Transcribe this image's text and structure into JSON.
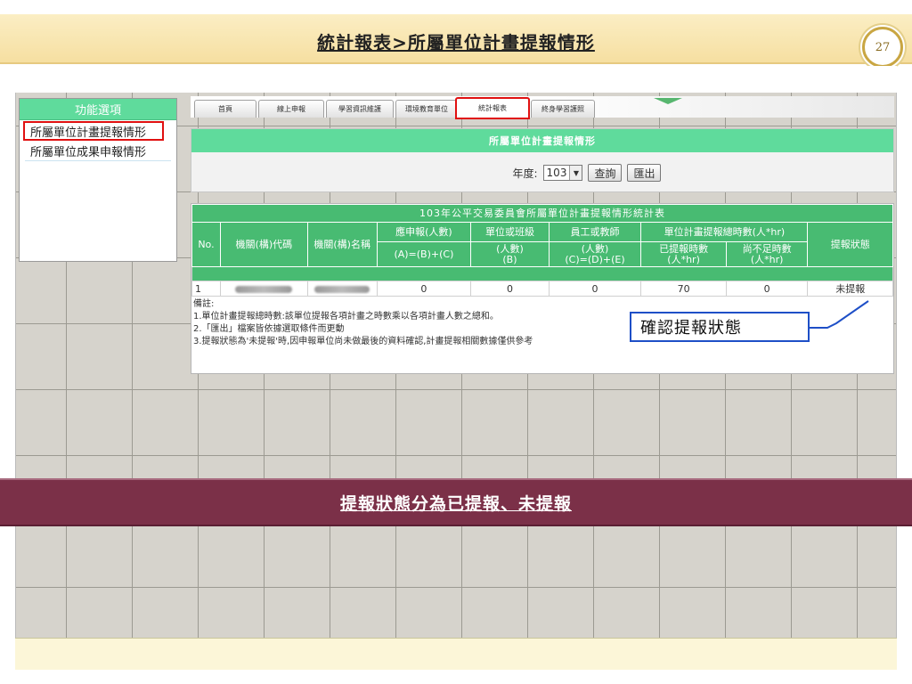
{
  "slide": {
    "title": "統計報表>所屬單位計畫提報情形",
    "page_number": "27",
    "banner": "提報狀態分為已提報、未提報",
    "callout": "確認提報狀態"
  },
  "sidebar": {
    "header": "功能選項",
    "items": [
      {
        "label": "所屬單位計畫提報情形",
        "active": true
      },
      {
        "label": "所屬單位成果申報情形",
        "active": false
      }
    ]
  },
  "tabs": [
    {
      "label": "首頁"
    },
    {
      "label": "線上申報"
    },
    {
      "label": "學習資訊維護"
    },
    {
      "label": "環境教育單位"
    },
    {
      "label": "統計報表",
      "active": true
    },
    {
      "label": "終身學習護照"
    }
  ],
  "main": {
    "title": "所屬單位計畫提報情形",
    "year_label": "年度:",
    "year_value": "103",
    "query_button": "查詢",
    "export_button": "匯出"
  },
  "report": {
    "caption": "103年公平交易委員會所屬單位計畫提報情形統計表",
    "headers": {
      "no": "No.",
      "code": "機關(構)代碼",
      "name": "機關(構)名稱",
      "a_top": "應申報(人數)",
      "a_bottom": "(A)=(B)+(C)",
      "b_top": "單位或班級",
      "b_mid": "(人數)",
      "b_bottom": "(B)",
      "c_top": "員工或教師",
      "c_mid": "(人數)",
      "c_bottom": "(C)=(D)+(E)",
      "hours_group": "單位計畫提報總時數(人*hr)",
      "reported_top": "已提報時數",
      "reported_bottom": "(人*hr)",
      "short_top": "尚不足時數",
      "short_bottom": "(人*hr)",
      "status": "提報狀態"
    },
    "rows": [
      {
        "no": "1",
        "a": "0",
        "b": "0",
        "c": "0",
        "reported": "70",
        "short": "0",
        "status": "未提報"
      }
    ],
    "notes": {
      "heading": "備註:",
      "line1": "1.單位計畫提報總時數:該單位提報各項計畫之時數乘以各項計畫人數之總和。",
      "line2": "2.「匯出」檔案皆依據選取條件而更動",
      "line3": "3.提報狀態為'未提報'時,因申報單位尚未做最後的資料確認,計畫提報相關數據僅供參考"
    }
  },
  "colors": {
    "header_green": "#5fdb9c",
    "table_green": "#48bb72",
    "highlight_red": "#e01010",
    "callout_blue": "#1e4fc7",
    "banner": "#7b3048"
  }
}
